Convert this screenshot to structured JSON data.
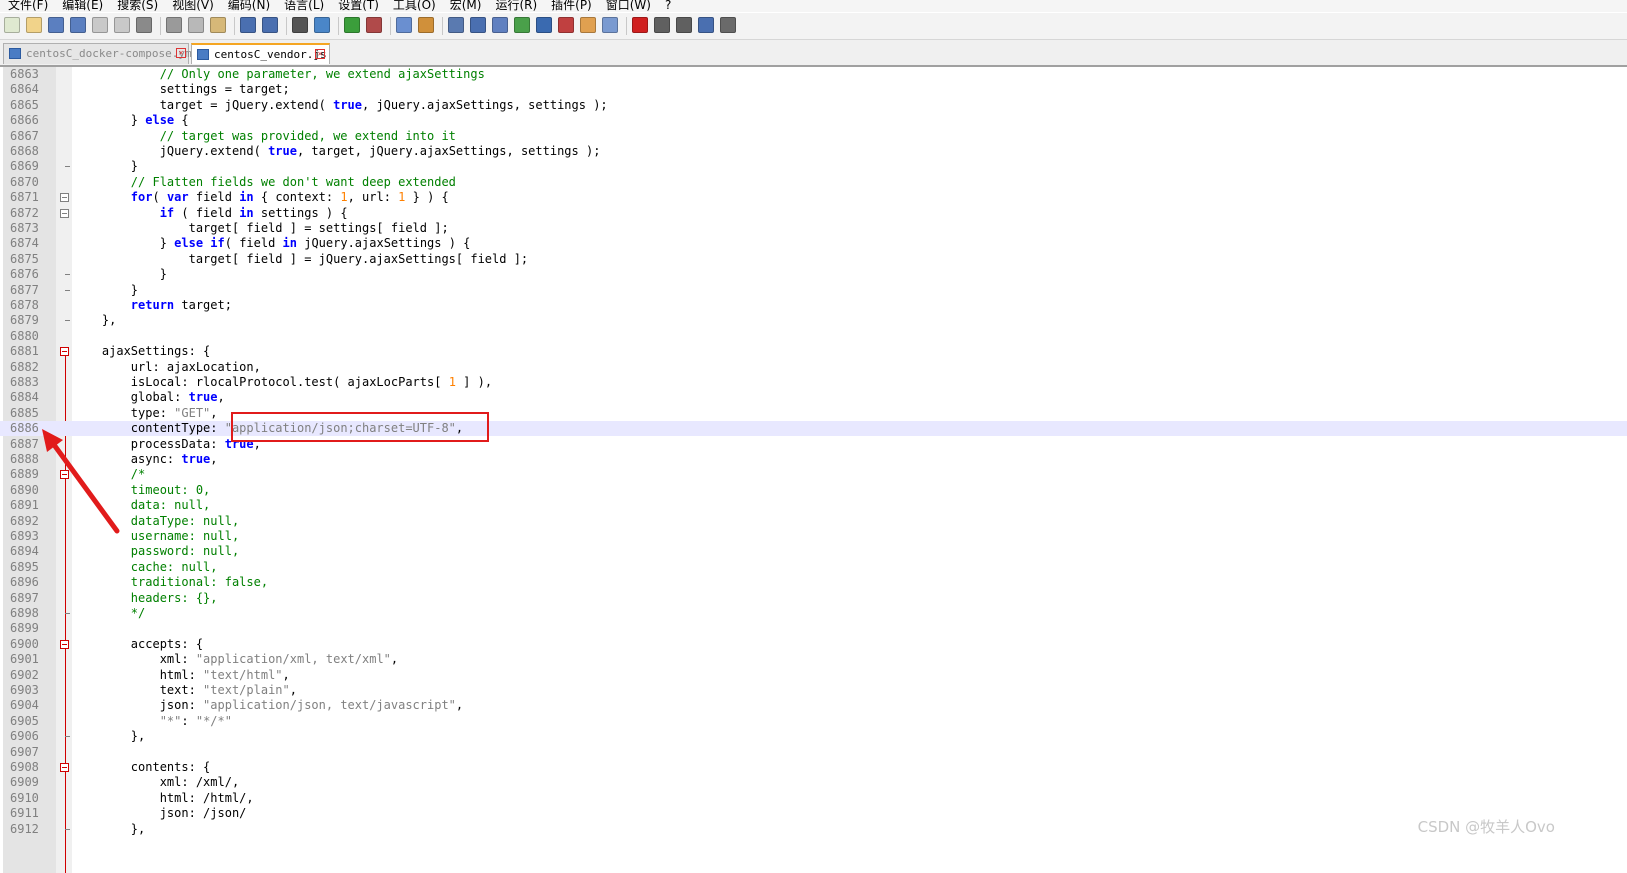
{
  "menu": [
    "文件(F)",
    "编辑(E)",
    "搜索(S)",
    "视图(V)",
    "编码(N)",
    "语言(L)",
    "设置(T)",
    "工具(O)",
    "宏(M)",
    "运行(R)",
    "插件(P)",
    "窗口(W)",
    "?"
  ],
  "toolbar_icons": [
    "new-file-icon",
    "open-file-icon",
    "save-icon",
    "save-all-icon",
    "close-icon",
    "close-all-icon",
    "print-icon",
    "cut-icon",
    "copy-icon",
    "paste-icon",
    "undo-icon",
    "redo-icon",
    "find-icon",
    "replace-icon",
    "zoom-in-icon",
    "zoom-out-icon",
    "sync-vertical-icon",
    "sync-horizontal-icon",
    "word-wrap-icon",
    "show-all-chars-icon",
    "indent-guide-icon",
    "lang-user-icon",
    "doc-map-icon",
    "function-list-icon",
    "folder-workspace-icon",
    "monitor-icon",
    "record-macro-icon",
    "stop-macro-icon",
    "play-macro-icon",
    "run-macro-multiple-icon",
    "save-macro-icon"
  ],
  "tabs": [
    {
      "label": "centosC_docker-compose.yml",
      "active": false
    },
    {
      "label": "centosC_vendor.js",
      "active": true
    }
  ],
  "editor": {
    "highlighted_line": "6886",
    "lines": [
      {
        "n": "6863",
        "t": "            // Only one parameter, we extend ajaxSettings"
      },
      {
        "n": "6864",
        "t": "            settings = target;"
      },
      {
        "n": "6865",
        "t": "            target = jQuery.extend( true, jQuery.ajaxSettings, settings );"
      },
      {
        "n": "6866",
        "t": "        } else {"
      },
      {
        "n": "6867",
        "t": "            // target was provided, we extend into it"
      },
      {
        "n": "6868",
        "t": "            jQuery.extend( true, target, jQuery.ajaxSettings, settings );"
      },
      {
        "n": "6869",
        "t": "        }"
      },
      {
        "n": "6870",
        "t": "        // Flatten fields we don't want deep extended"
      },
      {
        "n": "6871",
        "t": "        for( var field in { context: 1, url: 1 } ) {"
      },
      {
        "n": "6872",
        "t": "            if ( field in settings ) {"
      },
      {
        "n": "6873",
        "t": "                target[ field ] = settings[ field ];"
      },
      {
        "n": "6874",
        "t": "            } else if( field in jQuery.ajaxSettings ) {"
      },
      {
        "n": "6875",
        "t": "                target[ field ] = jQuery.ajaxSettings[ field ];"
      },
      {
        "n": "6876",
        "t": "            }"
      },
      {
        "n": "6877",
        "t": "        }"
      },
      {
        "n": "6878",
        "t": "        return target;"
      },
      {
        "n": "6879",
        "t": "    },"
      },
      {
        "n": "6880",
        "t": ""
      },
      {
        "n": "6881",
        "t": "    ajaxSettings: {"
      },
      {
        "n": "6882",
        "t": "        url: ajaxLocation,"
      },
      {
        "n": "6883",
        "t": "        isLocal: rlocalProtocol.test( ajaxLocParts[ 1 ] ),"
      },
      {
        "n": "6884",
        "t": "        global: true,"
      },
      {
        "n": "6885",
        "t": "        type: \"GET\","
      },
      {
        "n": "6886",
        "t": "        contentType: \"application/json;charset=UTF-8\","
      },
      {
        "n": "6887",
        "t": "        processData: true,"
      },
      {
        "n": "6888",
        "t": "        async: true,"
      },
      {
        "n": "6889",
        "t": "        /*"
      },
      {
        "n": "6890",
        "t": "        timeout: 0,"
      },
      {
        "n": "6891",
        "t": "        data: null,"
      },
      {
        "n": "6892",
        "t": "        dataType: null,"
      },
      {
        "n": "6893",
        "t": "        username: null,"
      },
      {
        "n": "6894",
        "t": "        password: null,"
      },
      {
        "n": "6895",
        "t": "        cache: null,"
      },
      {
        "n": "6896",
        "t": "        traditional: false,"
      },
      {
        "n": "6897",
        "t": "        headers: {},"
      },
      {
        "n": "6898",
        "t": "        */"
      },
      {
        "n": "6899",
        "t": ""
      },
      {
        "n": "6900",
        "t": "        accepts: {"
      },
      {
        "n": "6901",
        "t": "            xml: \"application/xml, text/xml\","
      },
      {
        "n": "6902",
        "t": "            html: \"text/html\","
      },
      {
        "n": "6903",
        "t": "            text: \"text/plain\","
      },
      {
        "n": "6904",
        "t": "            json: \"application/json, text/javascript\","
      },
      {
        "n": "6905",
        "t": "            \"*\": \"*/*\""
      },
      {
        "n": "6906",
        "t": "        },"
      },
      {
        "n": "6907",
        "t": ""
      },
      {
        "n": "6908",
        "t": "        contents: {"
      },
      {
        "n": "6909",
        "t": "            xml: /xml/,"
      },
      {
        "n": "6910",
        "t": "            html: /html/,"
      },
      {
        "n": "6911",
        "t": "            json: /json/"
      },
      {
        "n": "6912",
        "t": "        },"
      }
    ]
  },
  "watermark": "CSDN @牧羊人Ovo",
  "colors": {
    "annotation": "#e11b1b",
    "keyword": "#0000ff",
    "comment": "#008000",
    "string": "#808080",
    "number": "#ff8000"
  }
}
